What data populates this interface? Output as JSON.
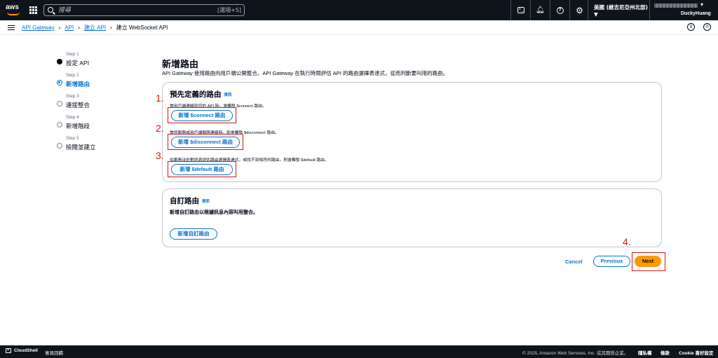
{
  "topnav": {
    "logo_text": "aws",
    "search_placeholder": "搜尋",
    "search_shortcut": "[選項+S]",
    "region": "美國 (維吉尼亞州北部) ▼",
    "username": "DuckyHuang"
  },
  "breadcrumb": {
    "items": [
      "API Gateway",
      "API",
      "建立 API"
    ],
    "current": "建立 WebSocket API"
  },
  "steps": [
    {
      "label": "Step 1",
      "name": "設定 API",
      "state": "done"
    },
    {
      "label": "Step 2",
      "name": "新增路由",
      "state": "active"
    },
    {
      "label": "Step 3",
      "name": "連接整合",
      "state": "todo"
    },
    {
      "label": "Step 4",
      "name": "新增階段",
      "state": "todo"
    },
    {
      "label": "Step 5",
      "name": "檢閱並建立",
      "state": "todo"
    }
  ],
  "page": {
    "title": "新增路由",
    "description": "API Gateway 使用路由向用戶端公開整合。API Gateway 在執行時間評估 API 的路由選擇表達式，從而判斷要叫用的路由。"
  },
  "predefined": {
    "title": "預先定義的路由",
    "info": "資訊",
    "connect_hint": "當用戶端連線到您的 API 時，會觸發 $connect 路由。",
    "connect_button": "新增 $connect 路由",
    "disconnect_hint": "當伺服器或用戶端關閉連線時，即會觸發 $disconnect 路由。",
    "disconnect_button": "新增 $disconnect 路由",
    "default_hint": "如果無法針對訊息評估路由選擇表達式，或找不到相符的路由，則會觸發 $default 路由。",
    "default_button": "新增 $default 路由"
  },
  "custom": {
    "title": "自訂路由",
    "info": "資訊",
    "description": "新增自訂路由以根據訊息內容叫用整合。",
    "button": "新增自訂路由"
  },
  "annotations": [
    "1.",
    "2.",
    "3.",
    "4."
  ],
  "actions": {
    "cancel": "Cancel",
    "previous": "Previous",
    "next": "Next"
  },
  "footer": {
    "cloudshell": "CloudShell",
    "feedback": "意見回饋",
    "copyright": "© 2025, Amazon Web Services, Inc. 或其關係企業。",
    "privacy": "隱私權",
    "terms": "條款",
    "cookies": "Cookie 喜好設定"
  },
  "colors": {
    "nav_bg": "#0f141a",
    "link": "#0972d3",
    "primary": "#ff9900",
    "annotation": "#d91515"
  }
}
